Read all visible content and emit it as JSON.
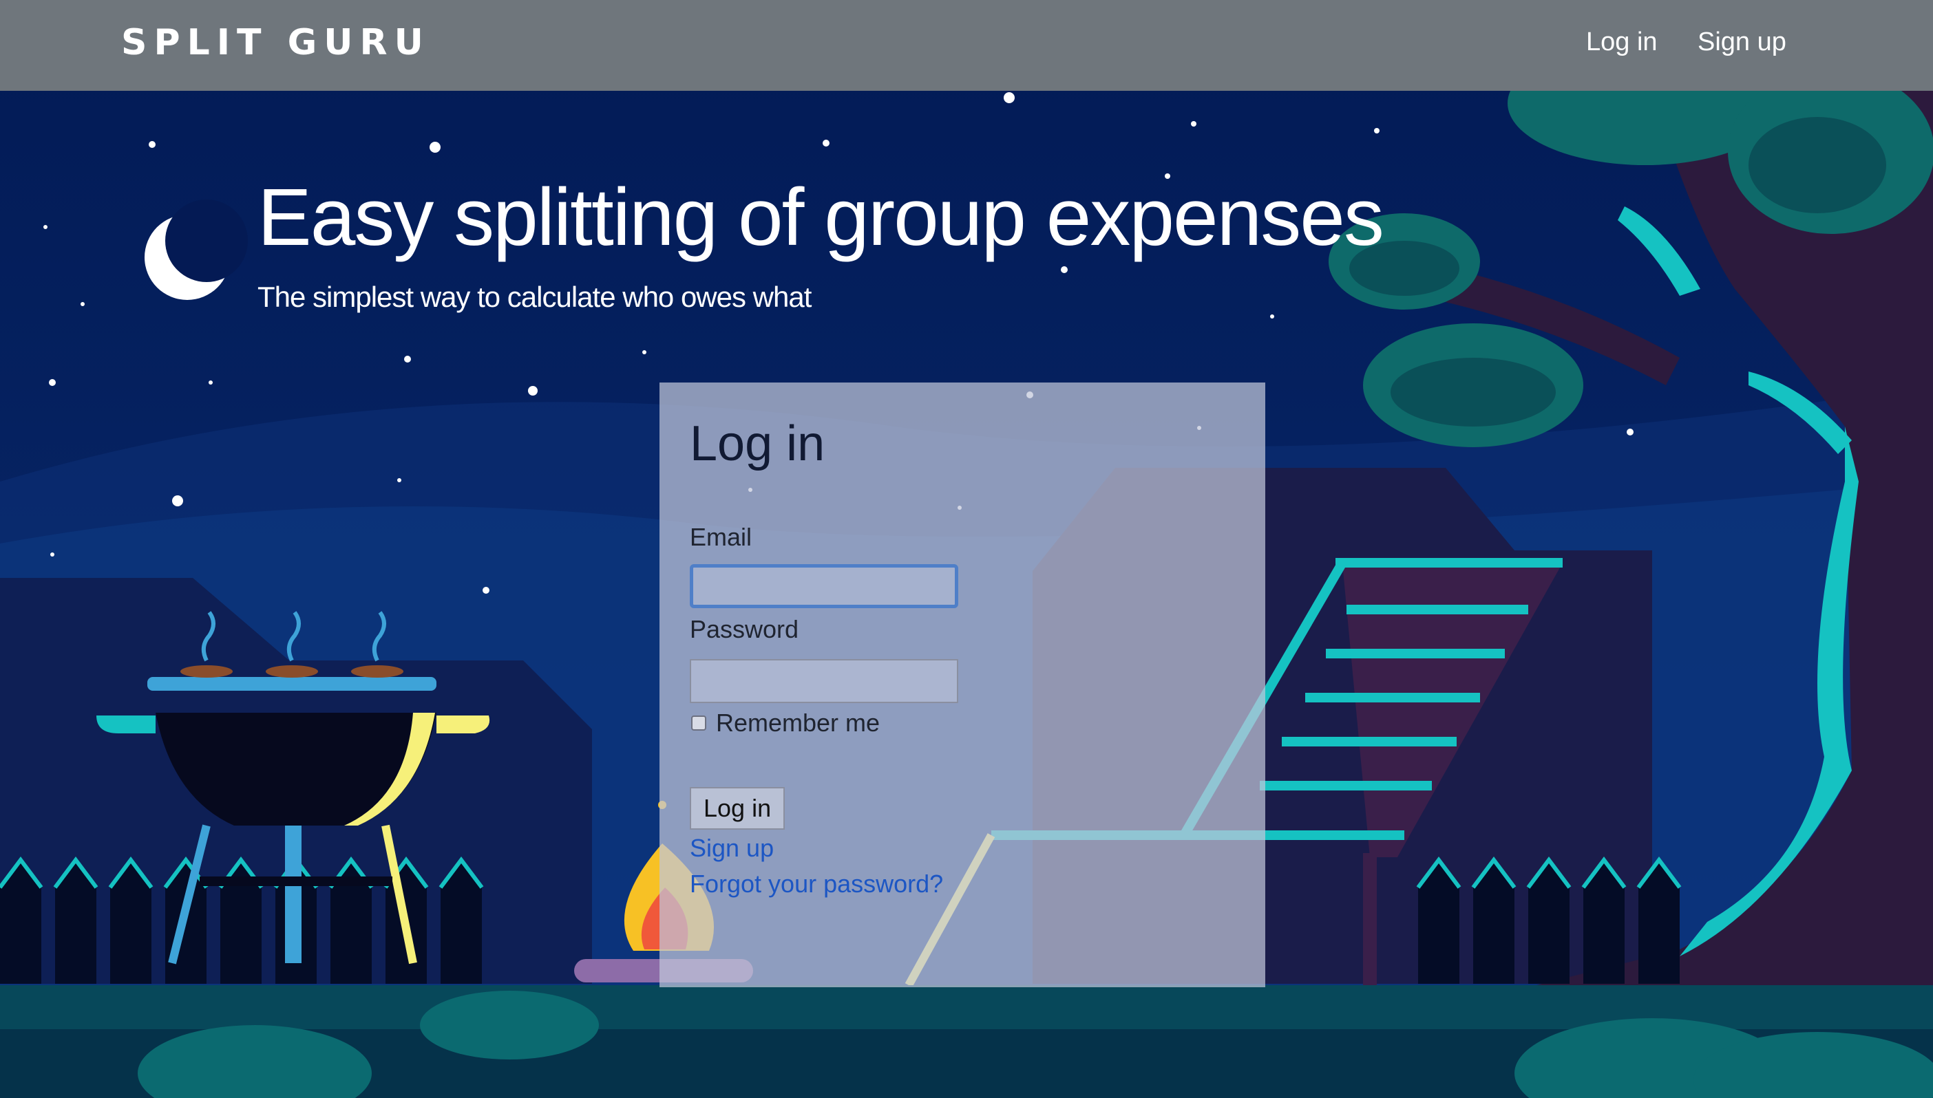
{
  "navbar": {
    "brand": "SPLIT GURU",
    "login_label": "Log in",
    "signup_label": "Sign up"
  },
  "hero": {
    "title": "Easy splitting of group expenses",
    "subtitle": "The simplest way to calculate who owes what"
  },
  "login_form": {
    "title": "Log in",
    "email_label": "Email",
    "email_value": "",
    "password_label": "Password",
    "password_value": "",
    "remember_label": "Remember me",
    "remember_checked": false,
    "submit_label": "Log in",
    "signup_link": "Sign up",
    "forgot_link": "Forgot your password?"
  },
  "colors": {
    "navbar_bg": "#6f767c",
    "sky": "#04164a",
    "link": "#1c56c4",
    "accent_teal": "#15c2c2",
    "grill_yellow": "#f6f07a"
  },
  "icons": [
    "moon-icon",
    "grill-icon",
    "campfire-icon",
    "tree-icon",
    "lounge-chair-icon"
  ]
}
